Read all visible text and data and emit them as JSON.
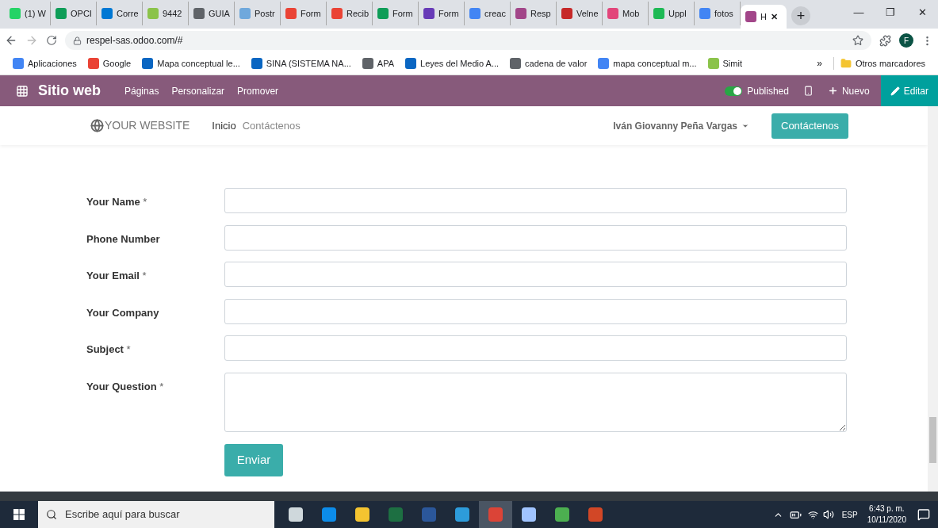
{
  "browser": {
    "tabs": [
      {
        "label": "(1) W",
        "color": "#25d366",
        "selected": false
      },
      {
        "label": "OPCI",
        "color": "#0f9d58",
        "selected": false
      },
      {
        "label": "Corre",
        "color": "#0078d4",
        "selected": false
      },
      {
        "label": "9442",
        "color": "#8bc34a",
        "selected": false
      },
      {
        "label": "GUIA",
        "color": "#5f6368",
        "selected": false
      },
      {
        "label": "Postr",
        "color": "#6fa8dc",
        "selected": false
      },
      {
        "label": "Form",
        "color": "#ea4335",
        "selected": false
      },
      {
        "label": "Recib",
        "color": "#ea4335",
        "selected": false
      },
      {
        "label": "Form",
        "color": "#0f9d58",
        "selected": false
      },
      {
        "label": "Form",
        "color": "#673ab7",
        "selected": false
      },
      {
        "label": "creac",
        "color": "#4285f4",
        "selected": false
      },
      {
        "label": "Resp",
        "color": "#a24689",
        "selected": false
      },
      {
        "label": "Velne",
        "color": "#c62828",
        "selected": false
      },
      {
        "label": "Mob",
        "color": "#e2457a",
        "selected": false
      },
      {
        "label": "Uppl",
        "color": "#1db954",
        "selected": false
      },
      {
        "label": "fotos",
        "color": "#4285f4",
        "selected": false
      },
      {
        "label": "H",
        "color": "#a24689",
        "selected": true
      }
    ],
    "close_tab": "✕",
    "new_tab": "+",
    "window_controls": [
      "—",
      "❐",
      "✕"
    ],
    "address": "respel-sas.odoo.com/#",
    "profile_initial": "F",
    "bookmarks": [
      {
        "label": "Aplicaciones",
        "color": "#4285f4"
      },
      {
        "label": "Google",
        "color": "#ea4335"
      },
      {
        "label": "Mapa conceptual le...",
        "color": "#0a66c2"
      },
      {
        "label": "SINA (SISTEMA NA...",
        "color": "#0a66c2"
      },
      {
        "label": "APA",
        "color": "#5f6368"
      },
      {
        "label": "Leyes del Medio A...",
        "color": "#0a66c2"
      },
      {
        "label": "cadena de valor",
        "color": "#5f6368"
      },
      {
        "label": "mapa conceptual m...",
        "color": "#4285f4"
      },
      {
        "label": "Simit",
        "color": "#8bc34a"
      }
    ],
    "bookmarks_overflow": "»",
    "other_bookmarks": "Otros marcadores"
  },
  "odoo_bar": {
    "app": "Sitio web",
    "menu": [
      "Páginas",
      "Personalizar",
      "Promover"
    ],
    "published": {
      "label": "Published",
      "on": true
    },
    "new": "Nuevo",
    "edit": "Editar"
  },
  "site_nav": {
    "logo": "YOUR WEBSITE",
    "links": [
      {
        "label": "Inicio",
        "selected": true
      },
      {
        "label": "Contáctenos",
        "selected": false
      }
    ],
    "user": "Iván Giovanny Peña Vargas",
    "cta": "Contáctenos"
  },
  "form": {
    "fields": [
      {
        "label": "Your Name",
        "mark": "*",
        "kind": "input"
      },
      {
        "label": "Phone Number",
        "kind": "input"
      },
      {
        "label": "Your Email",
        "mark": "*",
        "kind": "input"
      },
      {
        "label": "Your Company",
        "kind": "input"
      },
      {
        "label": "Subject",
        "mark": "*",
        "kind": "input"
      },
      {
        "label": "Your Question",
        "mark": "*",
        "kind": "textarea"
      }
    ],
    "submit": "Enviar"
  },
  "taskbar": {
    "search_placeholder": "Escribe aquí para buscar",
    "apps": [
      {
        "color": "#cfd8dc",
        "selected": false
      },
      {
        "color": "#0c8ce9",
        "selected": false
      },
      {
        "color": "#f4c430",
        "selected": false
      },
      {
        "color": "#1d6f42",
        "selected": false
      },
      {
        "color": "#2b579a",
        "selected": false
      },
      {
        "color": "#2d9cdb",
        "selected": false
      },
      {
        "color": "#db4437",
        "selected": true
      },
      {
        "color": "#a0c4ff",
        "selected": false
      },
      {
        "color": "#4caf50",
        "selected": false
      },
      {
        "color": "#d24726",
        "selected": false
      }
    ],
    "language": "ESP",
    "time": "6:43 p. m.",
    "date": "10/11/2020"
  }
}
